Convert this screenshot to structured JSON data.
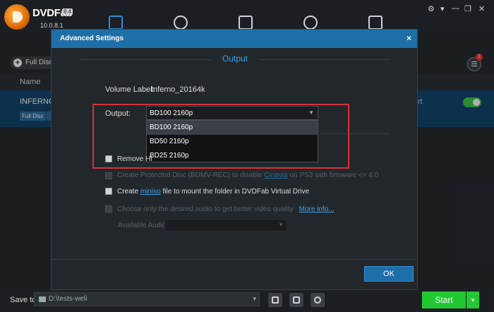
{
  "app": {
    "brand": "DVDFab",
    "brand_version": "8.4",
    "version": "10.0.8.1",
    "nav_icons": [
      "copy-icon",
      "ripper-icon",
      "video-converter-icon",
      "creator-icon",
      "toolbox-icon"
    ],
    "window_controls": [
      "⚙",
      "▾",
      "—",
      "❐",
      "✕"
    ]
  },
  "main": {
    "mode_button": "Full Disc",
    "column_name": "Name",
    "task": {
      "name": "INFERNO_",
      "badge": "Full Disc",
      "suffix": "rt",
      "enabled": true
    },
    "queue_badge": "1"
  },
  "dialog": {
    "title": "Advanced Settings",
    "close": "×",
    "section": "Output",
    "volume_label": "Volume Label:",
    "volume_value": "Inferno_20164k",
    "output_label": "Output:",
    "output_selected": "BD100 2160p",
    "output_options": [
      "BD100 2160p",
      "BD50 2160p",
      "BD25 2160p"
    ],
    "remove_hdr_label": "Remove HI",
    "protected_text_1": "Create Protected Disc (BDMV-REC) to disable ",
    "protected_link": "Cinavia",
    "protected_text_2": " on PS3 with firmware <= 4.0",
    "miniso_text_1": "Create ",
    "miniso_link": "miniso",
    "miniso_text_2": " file to mount the folder in DVDFab Virtual Drive",
    "audio_text": "Choose only the desired audio to get better video quality",
    "audio_link": "More info...",
    "available_audio_label": "Available Audio",
    "ok": "OK"
  },
  "bottom": {
    "save_to_label": "Save to:",
    "save_path": "D:\\tests-weli",
    "start": "Start"
  }
}
